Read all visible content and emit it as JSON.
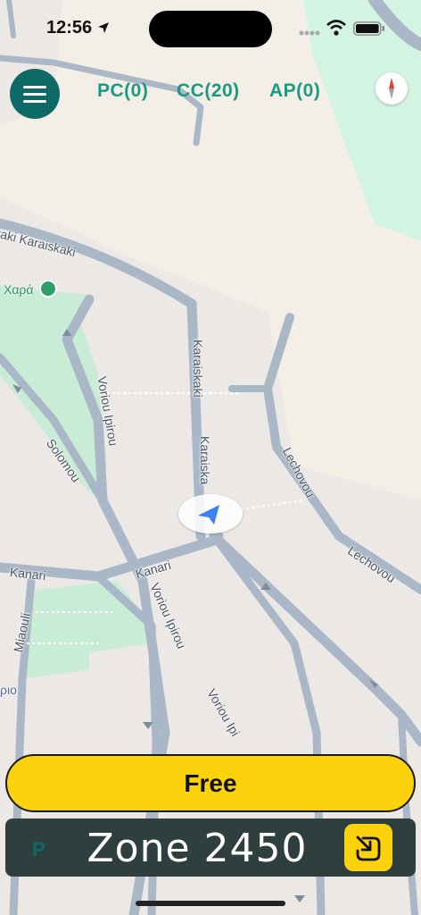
{
  "status_bar": {
    "time": "12:56"
  },
  "counters": {
    "pc": "PC(0)",
    "cc": "CC(20)",
    "ap": "AP(0)"
  },
  "map": {
    "labels": {
      "karaiskaki_top": "kaki Karaiskaki",
      "karaiskaki_v1": "Karaiskaki",
      "karaiskaki_v2": "Karaiska",
      "poi": "Χαρά",
      "voriou_ipirou_upper": "Voriou Ipirou",
      "solomou": "Solomou",
      "lechovou_upper": "Lechovou",
      "lechovou_lower": "Lechovou",
      "kanari_left": "Kanari",
      "kanari_mid": "Kanari",
      "voriou_ipirou_lower": "Voriou Ipirou",
      "voriou_ipirou_bottom": "Voriou Ipi",
      "miaouli": "Miaouli",
      "edge_place": "ριο"
    },
    "colors": {
      "park": "#c9ecd6",
      "building_area": "#f3efe6",
      "road": "#a9b7c6",
      "water_park": "#d3f4e3"
    }
  },
  "actions": {
    "free_label": "Free"
  },
  "zone": {
    "label": "Zone 2450",
    "p_icon": "P"
  },
  "icons": {
    "menu": "hamburger-icon",
    "compass": "compass-icon",
    "location": "navigation-arrow-icon",
    "zone_action": "enter-zone-icon"
  },
  "accent": {
    "teal": "#0e6a67",
    "yellow": "#fcd20d",
    "counter_text": "#1a9a80",
    "zone_bg": "#2e3f3e"
  }
}
